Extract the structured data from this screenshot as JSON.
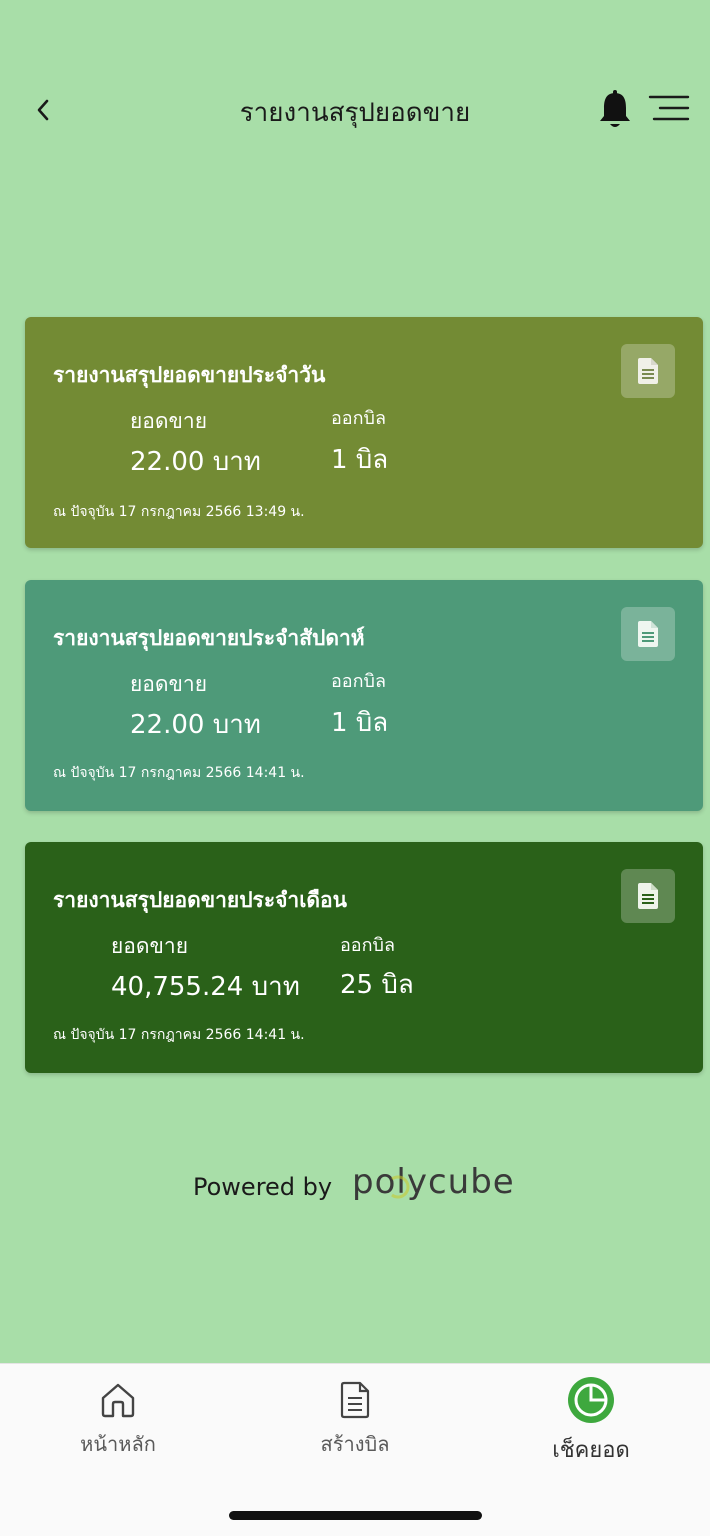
{
  "header": {
    "title": "รายงานสรุปยอดขาย"
  },
  "cards": [
    {
      "title": "รายงานสรุปยอดขายประจำวัน",
      "sales_label": "ยอดขาย",
      "sales_value": "22.00 บาท",
      "bills_label": "ออกบิล",
      "bills_value": "1 บิล",
      "timestamp": "ณ ปัจจุบัน 17 กรกฎาคม 2566 13:49 น.",
      "color": "#738b34"
    },
    {
      "title": "รายงานสรุปยอดขายประจำสัปดาห์",
      "sales_label": "ยอดขาย",
      "sales_value": "22.00 บาท",
      "bills_label": "ออกบิล",
      "bills_value": "1 บิล",
      "timestamp": "ณ ปัจจุบัน 17 กรกฎาคม 2566 14:41 น.",
      "color": "#4e9a79"
    },
    {
      "title": "รายงานสรุปยอดขายประจำเดือน",
      "sales_label": "ยอดขาย",
      "sales_value": "40,755.24 บาท",
      "bills_label": "ออกบิล",
      "bills_value": "25 บิล",
      "timestamp": "ณ ปัจจุบัน 17 กรกฎาคม 2566 14:41 น.",
      "color": "#2a6119"
    }
  ],
  "footer": {
    "powered_by": "Powered by",
    "brand": "polycube"
  },
  "tabbar": {
    "items": [
      {
        "label": "หน้าหลัก",
        "icon": "home-icon"
      },
      {
        "label": "สร้างบิล",
        "icon": "document-icon"
      },
      {
        "label": "เช็คยอด",
        "icon": "pie-chart-icon",
        "active": true
      }
    ]
  },
  "colors": {
    "background": "#a8dea8",
    "active_tab": "#3ea83e"
  }
}
